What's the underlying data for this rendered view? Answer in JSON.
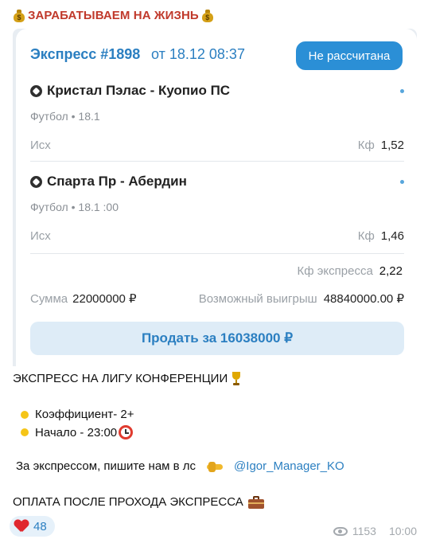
{
  "channel": {
    "title": "ЗАРАБАТЫВАЕМ НА ЖИЗНЬ",
    "emoji_icon": "money-bag-icon",
    "title_color": "#c0392b"
  },
  "bet": {
    "title": "Экспресс #1898",
    "date": "от 18.12 08:37",
    "status": "Не рассчитана",
    "accent_color": "#2b7fc1",
    "matches": [
      {
        "name": "Кристал Пэлас - Куопио ПС",
        "meta": "Футбол • 18.1",
        "outcome_label": "Исх",
        "odds_label": "Кф",
        "odds": "1,52"
      },
      {
        "name": "Спарта Пр - Абердин",
        "meta": "Футбол • 18.1   :00",
        "outcome_label": "Исх",
        "odds_label": "Кф",
        "odds": "1,46"
      }
    ],
    "total_odds_label": "Кф экспресса",
    "total_odds": "2,22",
    "stake_label": "Сумма",
    "stake_value": "22000000 ₽",
    "payout_label": "Возможный выигрыш",
    "payout_value": "48840000.00 ₽",
    "sell_button": "Продать за 16038000 ₽"
  },
  "message": {
    "headline": "ЭКСПРЕСС НА ЛИГУ КОНФЕРЕНЦИИ",
    "bullets": [
      "Коэффициент- 2+",
      "Начало - 23:00"
    ],
    "contact_text": "За экспрессом, пишите нам в лс",
    "contact_handle": "@Igor_Manager_KO",
    "footer_text": "ОПЛАТА ПОСЛЕ ПРОХОДА ЭКСПРЕССА"
  },
  "reactions": {
    "emoji": "heart-icon",
    "count": "48"
  },
  "post_meta": {
    "views": "1153",
    "time": "10:00"
  }
}
